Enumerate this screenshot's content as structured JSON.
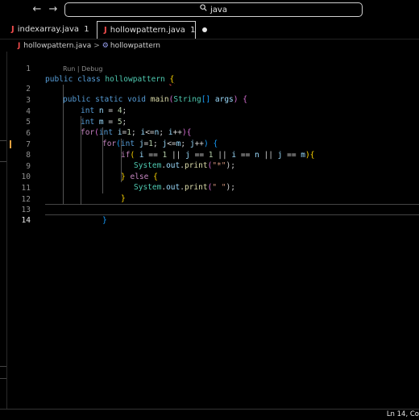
{
  "titlebar": {
    "search_text": "java"
  },
  "tabs": [
    {
      "label": "indexarray.java",
      "badge": "1"
    },
    {
      "label": "hollowpattern.java",
      "badge": "1"
    }
  ],
  "breadcrumb": {
    "file": "hollowpattern.java",
    "separator": ">",
    "symbol": "hollowpattern"
  },
  "codelens": {
    "run": "Run",
    "sep": "|",
    "debug": "Debug"
  },
  "line_numbers": [
    "1",
    "2",
    "3",
    "4",
    "5",
    "6",
    "7",
    "8",
    "9",
    "10",
    "11",
    "12",
    "13",
    "14"
  ],
  "code": {
    "l1": [
      "public",
      " ",
      "class",
      " ",
      "hollowpattern",
      " ",
      "{"
    ],
    "l2": [
      "public",
      " ",
      "static",
      " ",
      "void",
      " ",
      "main",
      "(",
      "String",
      "[]",
      " ",
      "args",
      ")",
      " ",
      "{"
    ],
    "l3": [
      "int",
      " ",
      "n",
      " = ",
      "4",
      ";"
    ],
    "l4": [
      "int",
      " ",
      "m",
      " = ",
      "5",
      ";"
    ],
    "l5": [
      "for",
      "(",
      "int",
      " ",
      "i",
      "=",
      "1",
      "; ",
      "i",
      "<=",
      "n",
      "; ",
      "i",
      "++",
      ")",
      "{"
    ],
    "l6": [
      "for",
      "(",
      "int",
      " ",
      "j",
      "=",
      "1",
      "; ",
      "j",
      "<=",
      "m",
      "; ",
      "j",
      "++",
      ")",
      " ",
      "{"
    ],
    "l7": [
      "if",
      "( ",
      "i",
      " == ",
      "1",
      " || ",
      "j",
      " == ",
      "1",
      " || ",
      "i",
      " == ",
      "n",
      " || ",
      "j",
      " == ",
      "m",
      ")",
      "{"
    ],
    "l8": [
      "System",
      ".",
      "out",
      ".",
      "print",
      "(",
      "\"*\"",
      ");"
    ],
    "l9": [
      "}",
      " ",
      "else",
      " ",
      "{"
    ],
    "l10": [
      "System",
      ".",
      "out",
      ".",
      "print",
      "(",
      "\" \"",
      ");"
    ],
    "l11": [
      "}"
    ],
    "l13": [
      "}"
    ]
  },
  "status": {
    "cursor": "Ln 14, Co"
  }
}
